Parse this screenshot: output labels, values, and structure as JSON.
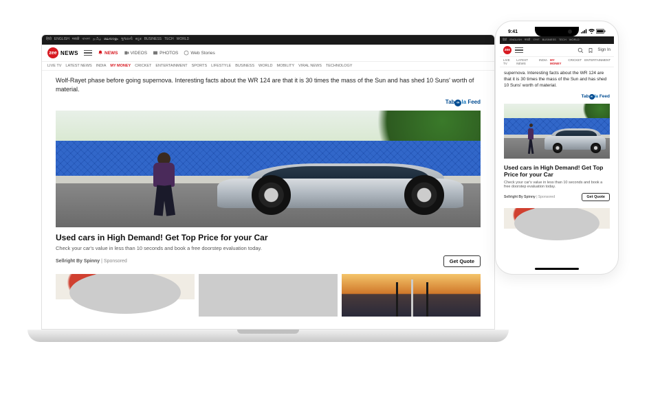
{
  "site": {
    "logo_badge": "zee",
    "logo_text": "NEWS"
  },
  "langstrip": [
    "हिंदी",
    "ENGLISH",
    "मराठी",
    "বাংলা",
    "தமிழ்",
    "മലയാളം",
    "ગુજરાતી",
    "ಕನ್ನಡ",
    "BUSINESS",
    "TECH",
    "WORLD",
    "..."
  ],
  "topnav": {
    "news": "NEWS",
    "videos": "VIDEOS",
    "photos": "PHOTOS",
    "webstories": "Web Stories"
  },
  "categories": [
    "LIVE TV",
    "LATEST NEWS",
    "INDIA",
    "MY MONEY",
    "CRICKET",
    "ENTERTAINMENT",
    "SPORTS",
    "LIFESTYLE",
    "BUSINESS",
    "WORLD",
    "MOBILITY",
    "VIRAL NEWS",
    "TECHNOLOGY"
  ],
  "article_snippet": "Wolf-Rayet phase before going supernova. Interesting facts about the WR 124 are that it is 30 times the mass of the Sun and has shed 10 Suns' worth of material.",
  "feed_label": "Tabla Feed",
  "ad": {
    "title": "Used cars in High Demand! Get Top Price for your Car",
    "desc": "Check your car's value in less than 10 seconds and book a free doorstep evaluation today.",
    "brand": "Sellright By Spinny",
    "sponsored": "Sponsored",
    "cta": "Get Quote"
  },
  "phone": {
    "time": "9:41",
    "article_snippet": "supernova. Interesting facts about the WR 124 are that it is 30 times the mass of the Sun and has shed 10 Suns' worth of material.",
    "signin": "Sign In",
    "categories": [
      "LIVE TV",
      "LATEST NEWS",
      "INDIA",
      "MY MONEY",
      "CRICKET",
      "ENTERTAINMENT"
    ]
  }
}
